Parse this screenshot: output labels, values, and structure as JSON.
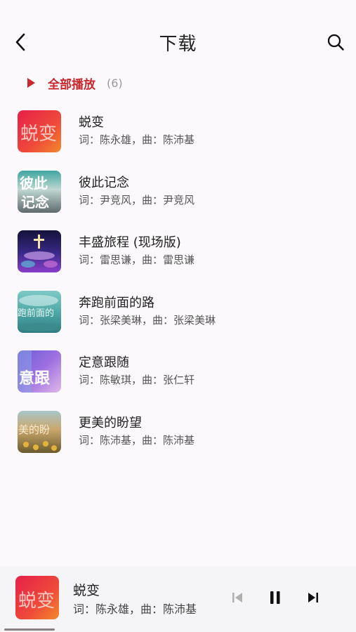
{
  "header": {
    "title": "下载"
  },
  "play_all": {
    "label": "全部播放",
    "count": "(6)"
  },
  "songs": [
    {
      "name": "蜕变",
      "meta": "词：陈永雄，曲：陈沛基"
    },
    {
      "name": "彼此记念",
      "meta": "词：尹竞风，曲：尹竞风"
    },
    {
      "name": "丰盛旅程 (现场版)",
      "meta": "词：雷思谦，曲：雷思谦"
    },
    {
      "name": "奔跑前面的路",
      "meta": "词：张梁美琳，曲：张梁美琳"
    },
    {
      "name": "定意跟随",
      "meta": "词：陈敏琪，曲：张仁轩"
    },
    {
      "name": "更美的盼望",
      "meta": "词：陈沛基，曲：陈沛基"
    }
  ],
  "cover_text": {
    "c1": "蜕变",
    "c2a": "彼此",
    "c2b": "记念",
    "c4": "跑前面的",
    "c5": "意跟",
    "c6": "美的盼"
  },
  "now_playing": {
    "name": "蜕变",
    "meta": "词：陈永雄，曲：陈沛基",
    "progress": 0.15
  },
  "colors": {
    "accent": "#c8282e"
  }
}
